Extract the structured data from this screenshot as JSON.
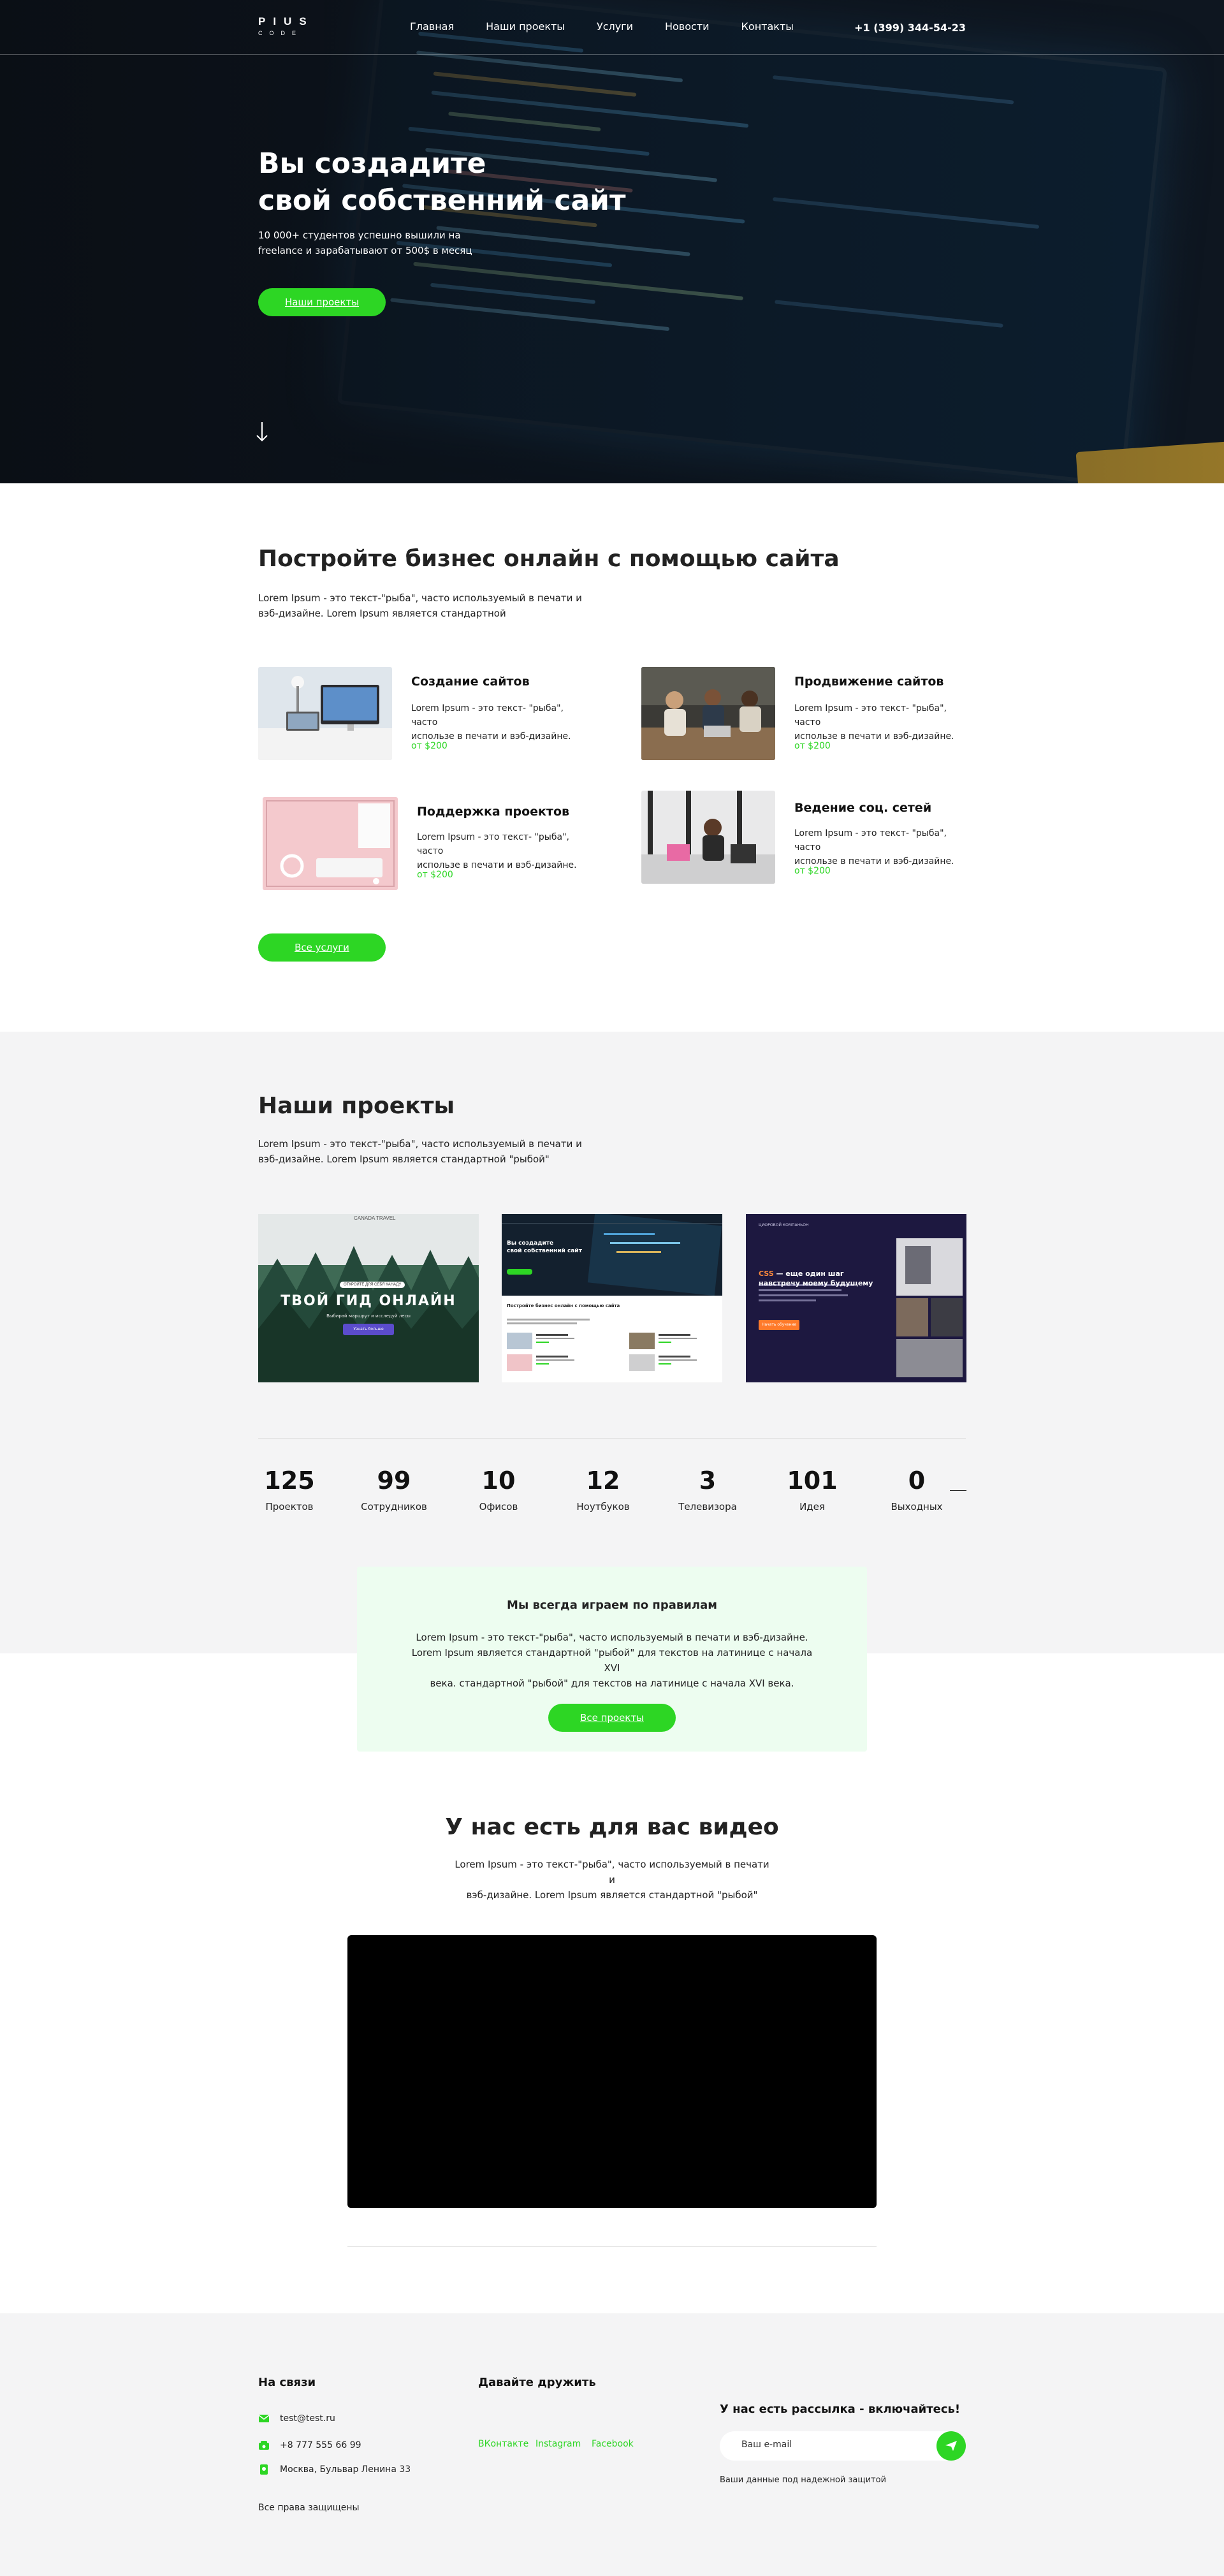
{
  "header": {
    "logo_top": "PIUS",
    "logo_bottom": "CODE",
    "nav": [
      "Главная",
      "Наши проекты",
      "Услуги",
      "Новости",
      "Контакты"
    ],
    "phone": "+1 (399) 344-54-23"
  },
  "hero": {
    "title_line1": "Вы создадите",
    "title_line2": "свой собственний сайт",
    "subtitle_line1": "10 000+ студентов успешно вышили на",
    "subtitle_line2": "freelance и зарабатывают от 500$ в месяц",
    "button": "Наши проекты",
    "scroll_icon": "arrow-down-icon"
  },
  "services": {
    "title": "Постройте бизнес онлайн с помощью сайта",
    "lead_line1": "Lorem Ipsum - это текст-\"рыба\", часто используемый в печати и",
    "lead_line2": "вэб-дизайне. Lorem Ipsum является стандартной",
    "items": [
      {
        "title": "Создание сайтов",
        "desc_line1": "Lorem Ipsum - это текст- \"рыба\", часто",
        "desc_line2": "использе в печати и вэб-дизайне.",
        "price": "от $200"
      },
      {
        "title": "Продвижение сайтов",
        "desc_line1": "Lorem Ipsum - это текст- \"рыба\", часто",
        "desc_line2": "использе в печати и вэб-дизайне.",
        "price": "от $200"
      },
      {
        "title": "Поддержка проектов",
        "desc_line1": "Lorem Ipsum - это текст- \"рыба\", часто",
        "desc_line2": "использе в печати и вэб-дизайне.",
        "price": "от $200"
      },
      {
        "title": "Ведение соц. сетей",
        "desc_line1": "Lorem Ipsum - это текст- \"рыба\", часто",
        "desc_line2": "использе в печати и вэб-дизайне.",
        "price": "от $200"
      }
    ],
    "button": "Все услуги"
  },
  "projects": {
    "title": "Наши проекты",
    "lead_line1": "Lorem Ipsum - это текст-\"рыба\", часто используемый в печати и",
    "lead_line2": "вэб-дизайне. Lorem Ipsum является стандартной \"рыбой\"",
    "cards": [
      {
        "brand": "CANADA TRAVEL",
        "badge": "ОТКРОЙТЕ ДЛЯ СЕБЯ КАНАДУ",
        "headline": "ТВОЙ ГИД ОНЛАЙН",
        "sub": "Выбирай маршрут и исследуй лесы",
        "button": "Узнать больше"
      },
      {
        "title_line1": "Вы создадите",
        "title_line2": "свой собственний сайт",
        "section": "Постройте бизнес онлайн с помощью сайта"
      },
      {
        "brand": "ЦИФРОВОЙ КОМПАНЬОН",
        "accent": "CSS",
        "headline_line1": " — еще один шаг",
        "headline_line2": "навстречу моему будущему",
        "button": "Начать обучение"
      }
    ]
  },
  "stats": [
    {
      "value": "125",
      "label": "Проектов"
    },
    {
      "value": "99",
      "label": "Сотрудников"
    },
    {
      "value": "10",
      "label": "Офисов"
    },
    {
      "value": "12",
      "label": "Ноутбуков"
    },
    {
      "value": "3",
      "label": "Телевизора"
    },
    {
      "value": "101",
      "label": "Идея"
    },
    {
      "value": "0",
      "label": "Выходных"
    }
  ],
  "rules": {
    "title": "Мы всегда играем по правилам",
    "line1": "Lorem Ipsum - это текст-\"рыба\", часто используемый в печати и вэб-дизайне.",
    "line2": "Lorem Ipsum является стандартной \"рыбой\" для текстов на латинице с начала XVI",
    "line3": "века.  стандартной \"рыбой\" для текстов на латинице с начала XVI века.",
    "button": "Все проекты"
  },
  "video": {
    "title": "У нас есть для вас видео",
    "lead_line1": "Lorem Ipsum - это текст-\"рыба\", часто используемый в печати и",
    "lead_line2": "вэб-дизайне. Lorem Ipsum является стандартной \"рыбой\""
  },
  "footer": {
    "contact_title": "На связи",
    "email": "test@test.ru",
    "phone": "+8 777 555 66 99",
    "address": "Москва, Бульвар Ленина 33",
    "rights": "Все права защищены",
    "social_title": "Давайте дружить",
    "socials": [
      "ВКонтакте",
      "Instagram",
      "Facebook"
    ],
    "newsletter_title": "У нас есть рассылка - включайтесь!",
    "email_placeholder": "Ваш e-mail",
    "privacy": "Ваши данные под надежной защитой"
  },
  "colors": {
    "accent": "#2dd624",
    "hero_bg": "#0f1823",
    "section_bg": "#f4f4f5",
    "rules_bg": "#edfdf0"
  }
}
